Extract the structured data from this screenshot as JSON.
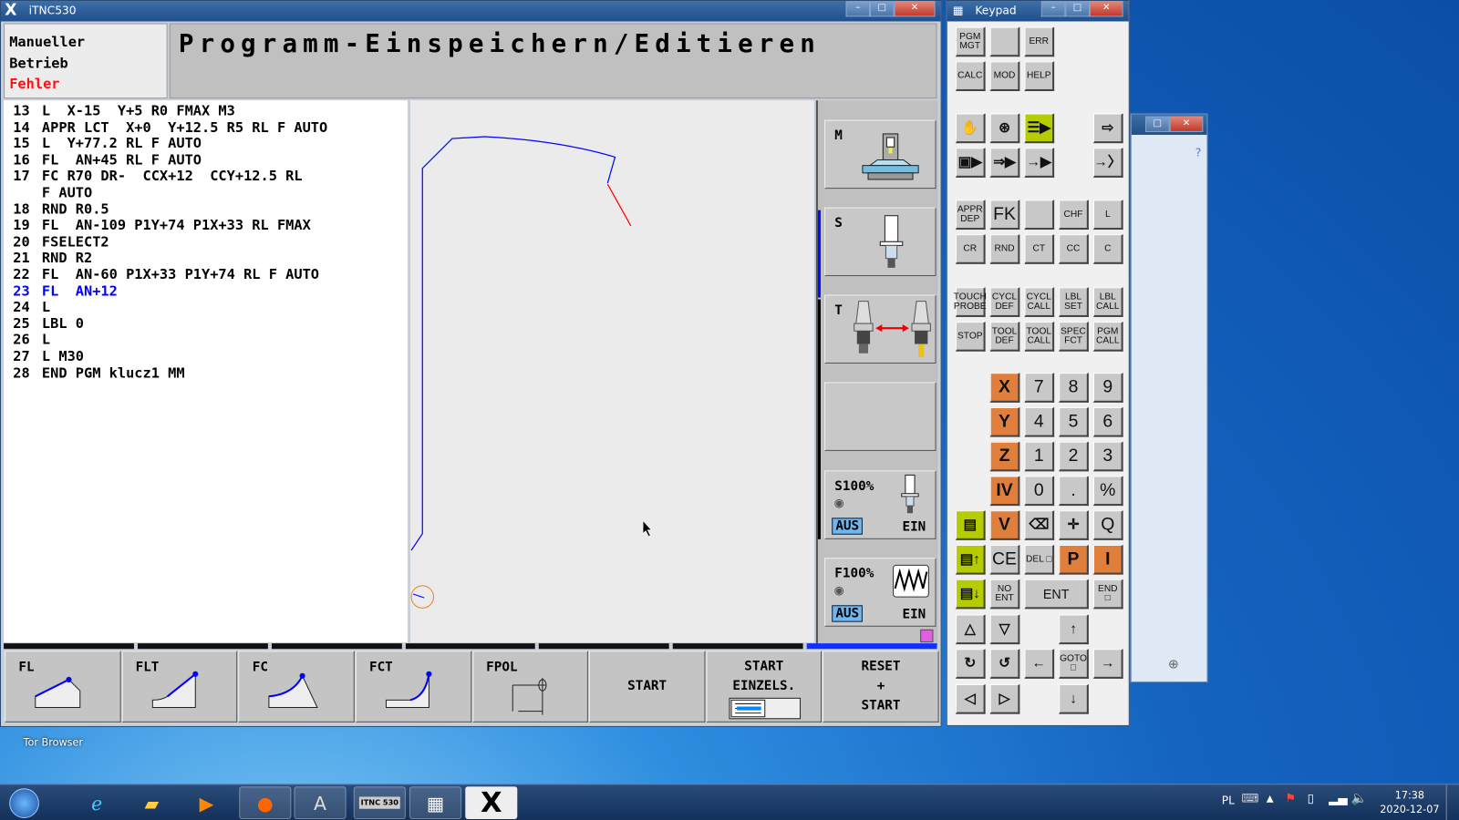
{
  "tnc_window": {
    "title": "iTNC530",
    "mode_left": [
      "Manueller",
      "Betrieb"
    ],
    "mode_error": "Fehler",
    "mode_title": "Programm-Einspeichern/Editieren",
    "program": [
      {
        "num": "13",
        "text": "L  X-15  Y+5 R0 FMAX M3"
      },
      {
        "num": "14",
        "text": "APPR LCT  X+0  Y+12.5 R5 RL F AUTO"
      },
      {
        "num": "15",
        "text": "L  Y+77.2 RL F AUTO"
      },
      {
        "num": "16",
        "text": "FL  AN+45 RL F AUTO"
      },
      {
        "num": "17",
        "text": "FC R70 DR-  CCX+12  CCY+12.5 RL"
      },
      {
        "num": "",
        "text": "F AUTO"
      },
      {
        "num": "18",
        "text": "RND R0.5"
      },
      {
        "num": "19",
        "text": "FL  AN-109 P1Y+74 P1X+33 RL FMAX"
      },
      {
        "num": "20",
        "text": "FSELECT2"
      },
      {
        "num": "21",
        "text": "RND R2"
      },
      {
        "num": "22",
        "text": "FL  AN-60 P1X+33 P1Y+74 RL F AUTO"
      },
      {
        "num": "23",
        "text": "FL  AN+12",
        "active": true
      },
      {
        "num": "24",
        "text": "L"
      },
      {
        "num": "25",
        "text": "LBL 0"
      },
      {
        "num": "26",
        "text": "L"
      },
      {
        "num": "27",
        "text": "L M30"
      },
      {
        "num": "28",
        "text": "END PGM klucz1 MM"
      }
    ],
    "side": {
      "m": "M",
      "s": "S",
      "t": "T",
      "s_override": "S100%",
      "f_override": "F100%",
      "aus": "AUS",
      "ein": "EIN"
    },
    "softkeys": [
      {
        "label": "FL",
        "icon": "fl-icon"
      },
      {
        "label": "FLT",
        "icon": "flt-icon"
      },
      {
        "label": "FC",
        "icon": "fc-icon"
      },
      {
        "label": "FCT",
        "icon": "fct-icon"
      },
      {
        "label": "FPOL",
        "icon": "fpol-icon"
      },
      {
        "label": "START"
      },
      {
        "label": "START\nEINZELS.",
        "icon": "single-block-icon"
      },
      {
        "label": "RESET\n+\nSTART"
      }
    ],
    "colors": {
      "active_line": "#0000ff",
      "error": "#ff0000",
      "contour": "#0000ff",
      "contour_error": "#ff0000"
    }
  },
  "keypad_window": {
    "title": "Keypad",
    "rows": [
      [
        {
          "l": "PGM MGT"
        },
        {
          "l": ""
        },
        {
          "l": "ERR"
        },
        null,
        null
      ],
      [
        {
          "l": "CALC"
        },
        {
          "l": "MOD"
        },
        {
          "l": "HELP"
        },
        null,
        null
      ],
      [
        {
          "i": "hand-icon",
          "g": "✋"
        },
        {
          "i": "handwheel-icon",
          "g": "⊛"
        },
        {
          "i": "program-run-icon",
          "g": "☰▶",
          "t": "green"
        },
        null,
        {
          "i": "position-icon",
          "g": "⇨"
        }
      ],
      [
        {
          "i": "program-run-single-icon",
          "g": "▣▶"
        },
        {
          "i": "program-run-full-icon",
          "g": "⇒▶"
        },
        {
          "i": "test-run-icon",
          "g": "→▶"
        },
        null,
        {
          "i": "program-edit-icon",
          "g": "→〉"
        }
      ],
      [
        {
          "l": "APPR DEP"
        },
        {
          "l": "FK",
          "t": "big0"
        },
        {
          "l": ""
        },
        {
          "l": "CHF"
        },
        {
          "l": "L"
        }
      ],
      [
        {
          "l": "CR"
        },
        {
          "l": "RND"
        },
        {
          "l": "CT"
        },
        {
          "l": "CC"
        },
        {
          "l": "C"
        }
      ],
      [
        {
          "l": "TOUCH PROBE"
        },
        {
          "l": "CYCL DEF"
        },
        {
          "l": "CYCL CALL"
        },
        {
          "l": "LBL SET"
        },
        {
          "l": "LBL CALL"
        }
      ],
      [
        {
          "l": "STOP"
        },
        {
          "l": "TOOL DEF"
        },
        {
          "l": "TOOL CALL"
        },
        {
          "l": "SPEC FCT"
        },
        {
          "l": "PGM CALL"
        }
      ],
      [
        null,
        {
          "l": "X",
          "t": "orange"
        },
        {
          "l": "7",
          "t": "num"
        },
        {
          "l": "8",
          "t": "num"
        },
        {
          "l": "9",
          "t": "num"
        }
      ],
      [
        null,
        {
          "l": "Y",
          "t": "orange"
        },
        {
          "l": "4",
          "t": "num"
        },
        {
          "l": "5",
          "t": "num"
        },
        {
          "l": "6",
          "t": "num"
        }
      ],
      [
        null,
        {
          "l": "Z",
          "t": "orange"
        },
        {
          "l": "1",
          "t": "num"
        },
        {
          "l": "2",
          "t": "num"
        },
        {
          "l": "3",
          "t": "num"
        }
      ],
      [
        null,
        {
          "l": "IV",
          "t": "orange"
        },
        {
          "l": "0",
          "t": "num"
        },
        {
          "l": ".",
          "t": "num"
        },
        {
          "l": "%",
          "t": "num"
        }
      ],
      [
        {
          "i": "screen-layout-icon",
          "g": "▤",
          "t": "green"
        },
        {
          "l": "V",
          "t": "orange"
        },
        {
          "i": "backspace-icon",
          "g": "⌫"
        },
        {
          "i": "actual-position-icon",
          "g": "✛"
        },
        {
          "l": "Q",
          "t": "num"
        }
      ],
      [
        {
          "i": "page-up-icon",
          "g": "▤↑",
          "t": "green"
        },
        {
          "l": "CE",
          "t": "num"
        },
        {
          "l": "DEL □"
        },
        {
          "l": "P",
          "t": "orange"
        },
        {
          "l": "I",
          "t": "orange"
        }
      ],
      [
        {
          "i": "page-down-icon",
          "g": "▤↓",
          "t": "green"
        },
        {
          "l": "NO ENT"
        },
        {
          "l": "ENT",
          "t": "wide"
        },
        "span",
        {
          "l": "END □"
        }
      ],
      [
        {
          "i": "triangle-up-icon",
          "g": "△"
        },
        {
          "i": "triangle-down-icon",
          "g": "▽"
        },
        null,
        {
          "i": "arrow-up-icon",
          "g": "↑"
        },
        null
      ],
      [
        {
          "i": "rotate-cw-icon",
          "g": "↻"
        },
        {
          "i": "rotate-ccw-icon",
          "g": "↺"
        },
        {
          "i": "arrow-left-icon",
          "g": "←"
        },
        {
          "l": "GOTO □"
        },
        {
          "i": "arrow-right-icon",
          "g": "→"
        }
      ],
      [
        {
          "i": "triangle-left-icon",
          "g": "◁"
        },
        {
          "i": "triangle-right-icon",
          "g": "▷"
        },
        null,
        {
          "i": "arrow-down-icon",
          "g": "↓"
        },
        null
      ]
    ]
  },
  "desktop": {
    "icon_label": "Tor Browser"
  },
  "taskbar": {
    "language": "PL",
    "time": "17:38",
    "date": "2020-12-07",
    "itnc_label": "ITNC 530"
  }
}
